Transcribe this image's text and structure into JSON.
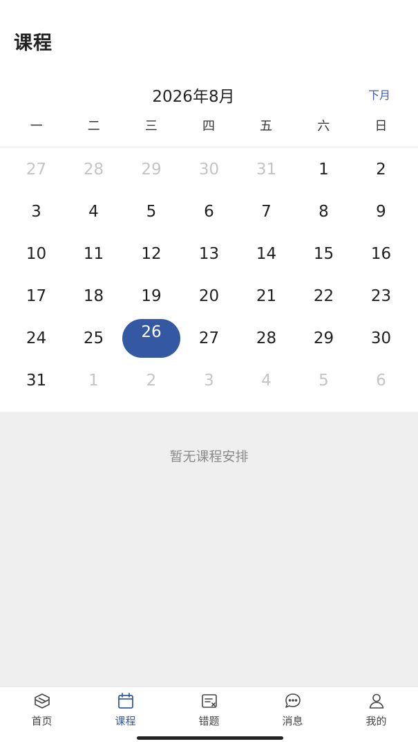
{
  "header": {
    "title": "课程"
  },
  "calendar": {
    "month_title": "2026年8月",
    "next_month_label": "下月",
    "weekdays": [
      "一",
      "二",
      "三",
      "四",
      "五",
      "六",
      "日"
    ],
    "selected_day": "26",
    "weeks": [
      [
        {
          "d": "27",
          "m": true
        },
        {
          "d": "28",
          "m": true
        },
        {
          "d": "29",
          "m": true
        },
        {
          "d": "30",
          "m": true
        },
        {
          "d": "31",
          "m": true
        },
        {
          "d": "1",
          "m": false
        },
        {
          "d": "2",
          "m": false
        }
      ],
      [
        {
          "d": "3",
          "m": false
        },
        {
          "d": "4",
          "m": false
        },
        {
          "d": "5",
          "m": false
        },
        {
          "d": "6",
          "m": false
        },
        {
          "d": "7",
          "m": false
        },
        {
          "d": "8",
          "m": false
        },
        {
          "d": "9",
          "m": false
        }
      ],
      [
        {
          "d": "10",
          "m": false
        },
        {
          "d": "11",
          "m": false
        },
        {
          "d": "12",
          "m": false
        },
        {
          "d": "13",
          "m": false
        },
        {
          "d": "14",
          "m": false
        },
        {
          "d": "15",
          "m": false
        },
        {
          "d": "16",
          "m": false
        }
      ],
      [
        {
          "d": "17",
          "m": false
        },
        {
          "d": "18",
          "m": false
        },
        {
          "d": "19",
          "m": false
        },
        {
          "d": "20",
          "m": false
        },
        {
          "d": "21",
          "m": false
        },
        {
          "d": "22",
          "m": false
        },
        {
          "d": "23",
          "m": false
        }
      ],
      [
        {
          "d": "24",
          "m": false
        },
        {
          "d": "25",
          "m": false
        },
        {
          "d": "26",
          "m": false
        },
        {
          "d": "27",
          "m": false
        },
        {
          "d": "28",
          "m": false
        },
        {
          "d": "29",
          "m": false
        },
        {
          "d": "30",
          "m": false
        }
      ],
      [
        {
          "d": "31",
          "m": false
        },
        {
          "d": "1",
          "m": true
        },
        {
          "d": "2",
          "m": true
        },
        {
          "d": "3",
          "m": true
        },
        {
          "d": "4",
          "m": true
        },
        {
          "d": "5",
          "m": true
        },
        {
          "d": "6",
          "m": true
        }
      ]
    ]
  },
  "schedule": {
    "empty_message": "暂无课程安排"
  },
  "tabbar": {
    "items": [
      {
        "label": "首页",
        "icon": "home-icon",
        "active": false
      },
      {
        "label": "课程",
        "icon": "calendar-icon",
        "active": true
      },
      {
        "label": "错题",
        "icon": "mistakes-icon",
        "active": false
      },
      {
        "label": "消息",
        "icon": "message-icon",
        "active": false
      },
      {
        "label": "我的",
        "icon": "profile-icon",
        "active": false
      }
    ]
  },
  "colors": {
    "accent": "#3459a2",
    "muted_day": "#c4c4c4",
    "empty_bg": "#efefef"
  }
}
